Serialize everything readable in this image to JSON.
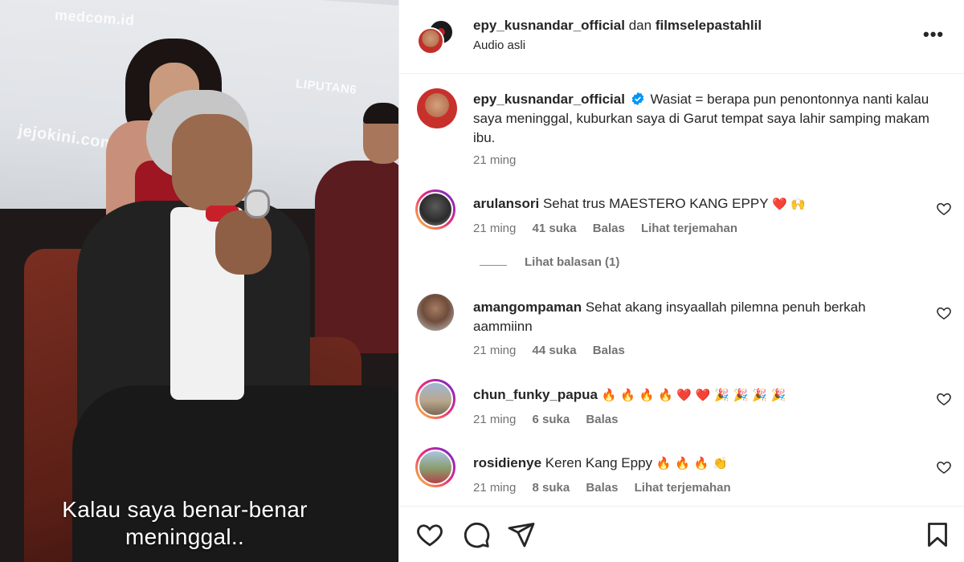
{
  "video": {
    "caption_line1": "Kalau saya benar-benar",
    "caption_line2": "meninggal..",
    "sponsors": [
      "medcom.id",
      "jejokini.com",
      "LIPUTAN6"
    ]
  },
  "header": {
    "user1": "epy_kusnandar_official",
    "connector": "dan",
    "user2": "filmselepastahlil",
    "subtitle": "Audio asli",
    "more_label": "•••"
  },
  "post": {
    "username": "epy_kusnandar_official",
    "caption": "Wasiat = berapa pun penontonnya nanti kalau saya meninggal, kuburkan saya di Garut tempat saya lahir samping makam ibu.",
    "time": "21 ming"
  },
  "comments": [
    {
      "username": "arulansori",
      "text": "Sehat trus MAESTERO KANG EPPY",
      "emoji": "❤️ 🙌",
      "time": "21 ming",
      "likes": "41 suka",
      "reply": "Balas",
      "translate": "Lihat terjemahan",
      "view_replies": "Lihat balasan (1)"
    },
    {
      "username": "amangompaman",
      "text": "Sehat akang insyaallah pilemna penuh berkah aammiinn",
      "time": "21 ming",
      "likes": "44 suka",
      "reply": "Balas"
    },
    {
      "username": "chun_funky_papua",
      "emoji": "🔥 🔥 🔥 🔥 ❤️ ❤️ 🎉 🎉 🎉 🎉",
      "time": "21 ming",
      "likes": "6 suka",
      "reply": "Balas"
    },
    {
      "username": "rosidienye",
      "text": "Keren Kang Eppy",
      "emoji": "🔥 🔥 🔥 👏",
      "time": "21 ming",
      "likes": "8 suka",
      "reply": "Balas",
      "translate": "Lihat terjemahan"
    }
  ],
  "colors": {
    "verified": "#0095f6",
    "text": "#262626",
    "muted": "#737373",
    "heart": "#e0245e"
  },
  "icons": [
    "heart-icon",
    "comment-icon",
    "share-icon",
    "bookmark-icon",
    "more-icon",
    "verified-icon"
  ]
}
